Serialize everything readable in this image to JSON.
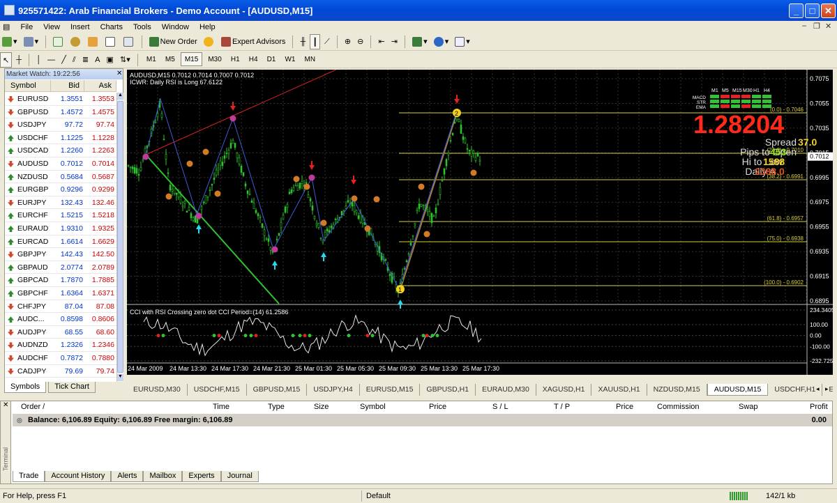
{
  "window": {
    "title": "925571422: Arab Financial Brokers - Demo Account - [AUDUSD,M15]"
  },
  "menu": [
    "File",
    "View",
    "Insert",
    "Charts",
    "Tools",
    "Window",
    "Help"
  ],
  "toolbar": {
    "new_order": "New Order",
    "expert_advisors": "Expert Advisors"
  },
  "draw_tools": {
    "text": "A"
  },
  "timeframes": [
    "M1",
    "M5",
    "M15",
    "M30",
    "H1",
    "H4",
    "D1",
    "W1",
    "MN"
  ],
  "active_timeframe": "M15",
  "market_watch": {
    "title": "Market Watch: 19:22:56",
    "columns": [
      "Symbol",
      "Bid",
      "Ask"
    ],
    "rows": [
      {
        "symbol": "EURUSD",
        "bid": "1.3551",
        "ask": "1.3553",
        "dir": "down"
      },
      {
        "symbol": "GBPUSD",
        "bid": "1.4572",
        "ask": "1.4575",
        "dir": "down"
      },
      {
        "symbol": "USDJPY",
        "bid": "97.72",
        "ask": "97.74",
        "dir": "down"
      },
      {
        "symbol": "USDCHF",
        "bid": "1.1225",
        "ask": "1.1228",
        "dir": "up"
      },
      {
        "symbol": "USDCAD",
        "bid": "1.2260",
        "ask": "1.2263",
        "dir": "up"
      },
      {
        "symbol": "AUDUSD",
        "bid": "0.7012",
        "ask": "0.7014",
        "dir": "down"
      },
      {
        "symbol": "NZDUSD",
        "bid": "0.5684",
        "ask": "0.5687",
        "dir": "up"
      },
      {
        "symbol": "EURGBP",
        "bid": "0.9296",
        "ask": "0.9299",
        "dir": "up"
      },
      {
        "symbol": "EURJPY",
        "bid": "132.43",
        "ask": "132.46",
        "dir": "down"
      },
      {
        "symbol": "EURCHF",
        "bid": "1.5215",
        "ask": "1.5218",
        "dir": "up"
      },
      {
        "symbol": "EURAUD",
        "bid": "1.9310",
        "ask": "1.9325",
        "dir": "up"
      },
      {
        "symbol": "EURCAD",
        "bid": "1.6614",
        "ask": "1.6629",
        "dir": "up"
      },
      {
        "symbol": "GBPJPY",
        "bid": "142.43",
        "ask": "142.50",
        "dir": "down"
      },
      {
        "symbol": "GBPAUD",
        "bid": "2.0774",
        "ask": "2.0789",
        "dir": "up"
      },
      {
        "symbol": "GBPCAD",
        "bid": "1.7870",
        "ask": "1.7885",
        "dir": "up"
      },
      {
        "symbol": "GBPCHF",
        "bid": "1.6364",
        "ask": "1.6371",
        "dir": "up"
      },
      {
        "symbol": "CHFJPY",
        "bid": "87.04",
        "ask": "87.08",
        "dir": "down"
      },
      {
        "symbol": "AUDC...",
        "bid": "0.8598",
        "ask": "0.8606",
        "dir": "up"
      },
      {
        "symbol": "AUDJPY",
        "bid": "68.55",
        "ask": "68.60",
        "dir": "down"
      },
      {
        "symbol": "AUDNZD",
        "bid": "1.2326",
        "ask": "1.2346",
        "dir": "down"
      },
      {
        "symbol": "AUDCHF",
        "bid": "0.7872",
        "ask": "0.7880",
        "dir": "down"
      },
      {
        "symbol": "CADJPY",
        "bid": "79.69",
        "ask": "79.74",
        "dir": "down"
      }
    ],
    "tabs": [
      "Symbols",
      "Tick Chart"
    ]
  },
  "chart": {
    "header": "AUDUSD,M15  0.7012 0.7014 0.7007 0.7012",
    "indicator_line": "ICWR: Daily RSI is Long 67.6122",
    "price_big": "1.28204",
    "spread_label": "Spread",
    "spread_value": "37.0",
    "pips_label": "Pips to Open",
    "pips_value": "453",
    "hilo_label": "Hi to Low",
    "hilo_value": "1588",
    "daily_label": "Daily A",
    "daily_value": "2388.0",
    "dash_cols": [
      "M1",
      "M5",
      "M15",
      "M30",
      "H1",
      "H4"
    ],
    "dash_rows": [
      "MACD",
      "STR",
      "EMA"
    ],
    "fib_labels": [
      "(0.0) - 0.7046",
      "(23.6) - 0.7010",
      "(38.2) - 0.6991",
      "(61.8) - 0.6957",
      "(75.0) - 0.6938",
      "(100.0) - 0.6902"
    ],
    "price_axis": [
      "0.7075",
      "0.7055",
      "0.7035",
      "0.7015",
      "0.6995",
      "0.6975",
      "0.6955",
      "0.6935",
      "0.6915",
      "0.6895"
    ],
    "current_price": "0.7012",
    "cci_title": "CCI with RSI Crossing zero dot CCI Period=(14) 61.2586",
    "cci_axis": [
      "234.3405",
      "100.00",
      "0.00",
      "-100.00",
      "-232.725"
    ],
    "time_axis": [
      "24 Mar 2009",
      "24 Mar 13:30",
      "24 Mar 17:30",
      "24 Mar 21:30",
      "25 Mar 01:30",
      "25 Mar 05:30",
      "25 Mar 09:30",
      "25 Mar 13:30",
      "25 Mar 17:30"
    ],
    "fib_label_1": "1",
    "fib_label_2": "2"
  },
  "chart_tabs": [
    "EURUSD,M30",
    "USDCHF,M15",
    "GBPUSD,M15",
    "USDJPY,H4",
    "EURUSD,M15",
    "GBPUSD,H1",
    "EURAUD,M30",
    "XAGUSD,H1",
    "XAUUSD,H1",
    "NZDUSD,M15",
    "AUDUSD,M15",
    "USDCHF,H1",
    "EURG"
  ],
  "active_chart_tab": "AUDUSD,M15",
  "terminal": {
    "columns": [
      "Order",
      "Time",
      "Type",
      "Size",
      "Symbol",
      "Price",
      "S / L",
      "T / P",
      "Price",
      "Commission",
      "Swap",
      "Profit"
    ],
    "balance": "Balance: 6,106.89  Equity: 6,106.89  Free margin: 6,106.89",
    "profit": "0.00",
    "tabs": [
      "Trade",
      "Account History",
      "Alerts",
      "Mailbox",
      "Experts",
      "Journal"
    ],
    "side_label": "Terminal"
  },
  "status": {
    "help": "For Help, press F1",
    "profile": "Default",
    "traffic": "142/1 kb"
  }
}
